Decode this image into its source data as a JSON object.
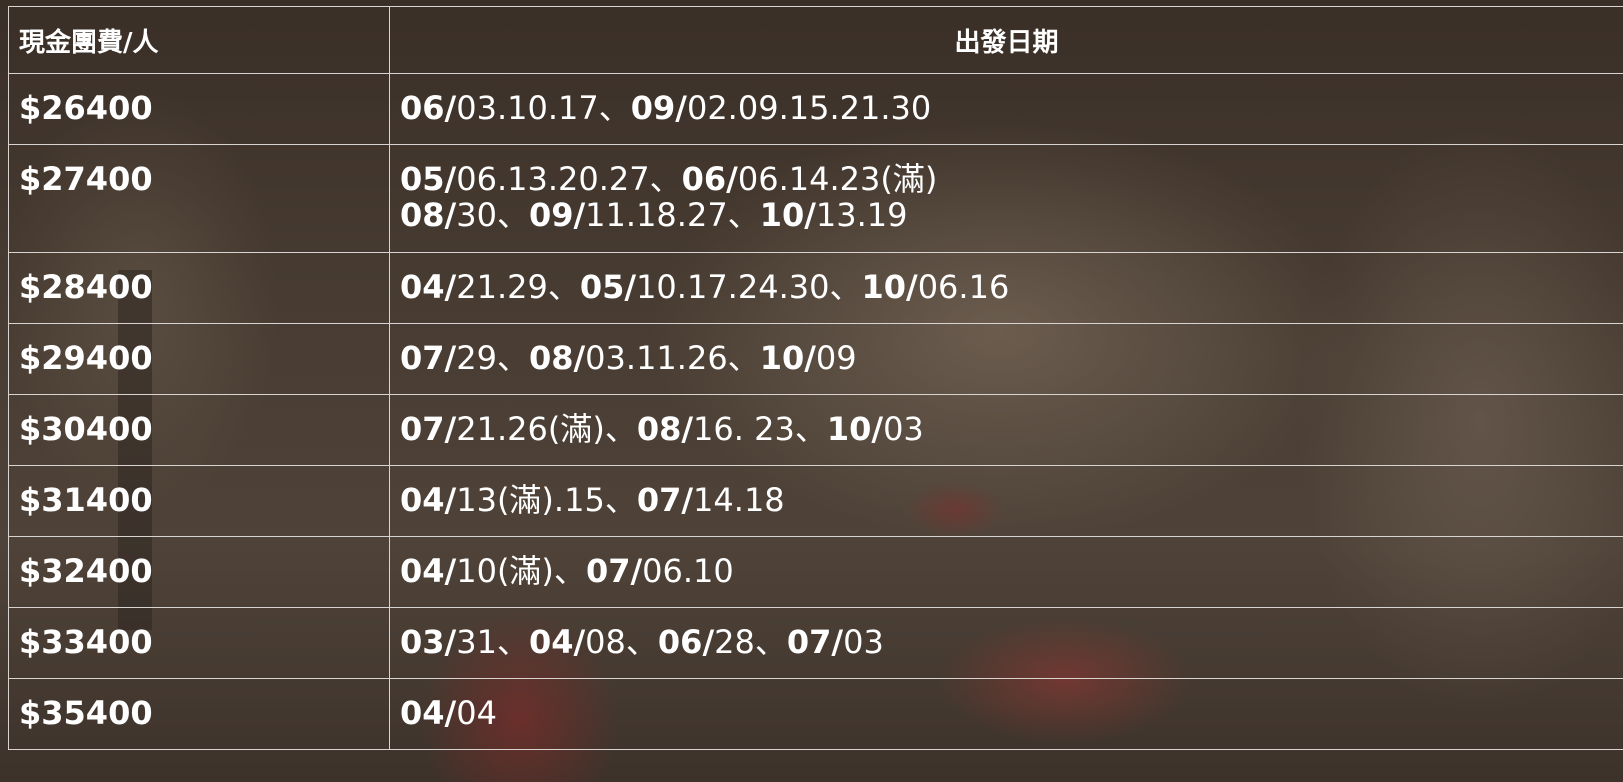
{
  "table": {
    "headers": {
      "price": "現金團費/人",
      "dates": "出發日期"
    },
    "rows": [
      {
        "price": "$26400",
        "lines": [
          [
            {
              "month": "06/",
              "days": "03.10.17"
            },
            {
              "month": "09/",
              "days": "02.09.15.21.30"
            }
          ]
        ]
      },
      {
        "price": "$27400",
        "lines": [
          [
            {
              "month": "05/",
              "days": "06.13.20.27"
            },
            {
              "month": "06/",
              "days": "06.14.23(滿)"
            }
          ],
          [
            {
              "month": "08/",
              "days": "30"
            },
            {
              "month": "09/",
              "days": "11.18.27"
            },
            {
              "month": "10/",
              "days": "13.19"
            }
          ]
        ]
      },
      {
        "price": "$28400",
        "lines": [
          [
            {
              "month": "04/",
              "days": "21.29"
            },
            {
              "month": "05/",
              "days": "10.17.24.30"
            },
            {
              "month": "10/",
              "days": "06.16"
            }
          ]
        ]
      },
      {
        "price": "$29400",
        "lines": [
          [
            {
              "month": "07/",
              "days": "29"
            },
            {
              "month": "08/",
              "days": "03.11.26"
            },
            {
              "month": "10/",
              "days": "09"
            }
          ]
        ]
      },
      {
        "price": "$30400",
        "lines": [
          [
            {
              "month": "07/",
              "days": "21.26(滿)"
            },
            {
              "month": "08/",
              "days": "16. 23"
            },
            {
              "month": "10/",
              "days": "03"
            }
          ]
        ]
      },
      {
        "price": "$31400",
        "lines": [
          [
            {
              "month": "04/",
              "days": "13(滿).15"
            },
            {
              "month": "07/",
              "days": "14.18"
            }
          ]
        ]
      },
      {
        "price": "$32400",
        "lines": [
          [
            {
              "month": "04/",
              "days": "10(滿)"
            },
            {
              "month": "07/",
              "days": "06.10"
            }
          ]
        ]
      },
      {
        "price": "$33400",
        "lines": [
          [
            {
              "month": "03/",
              "days": "31"
            },
            {
              "month": "04/",
              "days": "08"
            },
            {
              "month": "06/",
              "days": "28"
            },
            {
              "month": "07/",
              "days": "03"
            }
          ]
        ]
      },
      {
        "price": "$35400",
        "lines": [
          [
            {
              "month": "04/",
              "days": "04"
            }
          ]
        ]
      }
    ],
    "separator": "、"
  }
}
